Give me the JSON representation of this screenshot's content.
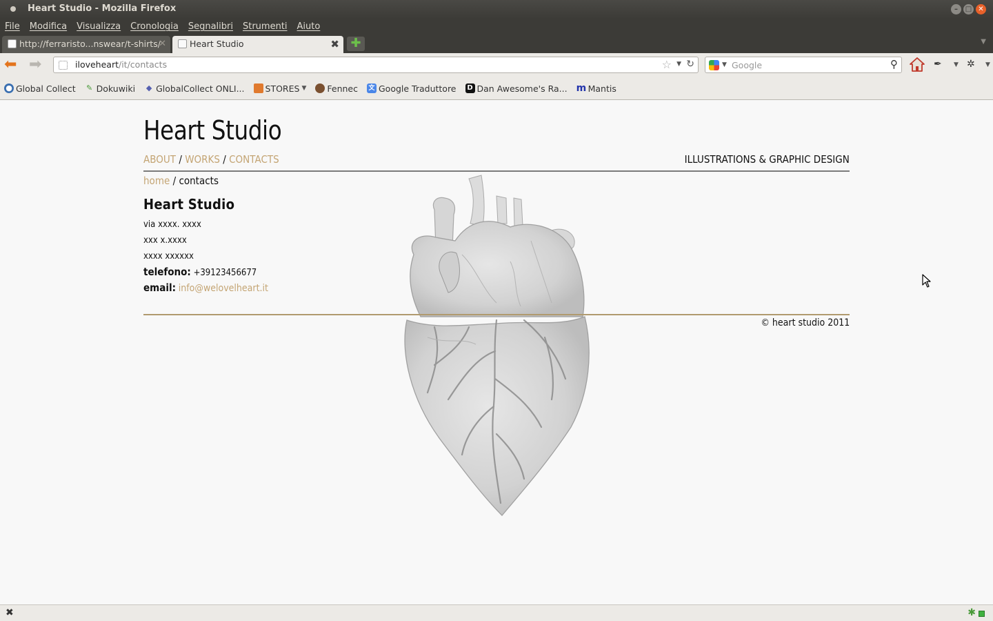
{
  "window": {
    "title": "Heart Studio - Mozilla Firefox"
  },
  "menu": [
    "File",
    "Modifica",
    "Visualizza",
    "Cronologia",
    "Segnalibri",
    "Strumenti",
    "Aiuto"
  ],
  "tabs": [
    {
      "label": "http://ferraristo...nswear/t-shirts/"
    },
    {
      "label": "Heart Studio"
    }
  ],
  "navbar": {
    "url_host": "iloveheart",
    "url_path": "/it/contacts",
    "search_placeholder": "Google"
  },
  "bookmarks": [
    {
      "label": "Global Collect",
      "icon": "globe-icon"
    },
    {
      "label": "Dokuwiki",
      "icon": "pencil-icon"
    },
    {
      "label": "GlobalCollect ONLI...",
      "icon": "diamond-icon"
    },
    {
      "label": "STORES",
      "icon": "folder-icon"
    },
    {
      "label": "Fennec",
      "icon": "fox-icon"
    },
    {
      "label": "Google Traduttore",
      "icon": "translate-icon"
    },
    {
      "label": "Dan Awesome's Ra...",
      "icon": "dan-icon"
    },
    {
      "label": "Mantis",
      "icon": "mantis-icon"
    }
  ],
  "site": {
    "title": "Heart Studio",
    "nav": [
      "ABOUT",
      "WORKS",
      "CONTACTS"
    ],
    "nav_sep": "/",
    "tagline": "ILLUSTRATIONS & GRAPHIC DESIGN",
    "breadcrumb_home": "home",
    "breadcrumb_sep": "/",
    "breadcrumb_current": "contacts",
    "contact": {
      "name": "Heart Studio",
      "address1": "via xxxx. xxxx",
      "address2": "xxx x.xxxx",
      "address3": "xxxx xxxxxx",
      "phone_label": "telefono:",
      "phone": "+39123456677",
      "email_label": "email:",
      "email": "info@welovelheart.it"
    },
    "copyright": "© heart studio 2011"
  },
  "colors": {
    "accent": "#c4a574",
    "chrome_dark": "#3c3b37",
    "chrome_light": "#eceae6",
    "page_bg": "#f8f8f8"
  }
}
